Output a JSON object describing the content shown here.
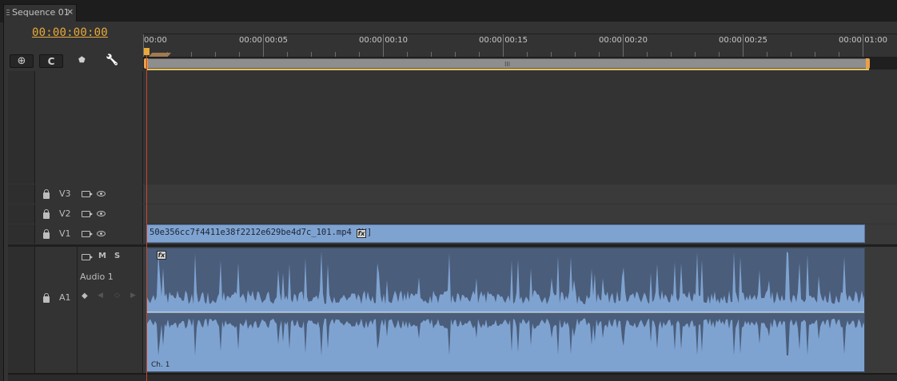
{
  "tab": {
    "label": "Sequence 01",
    "close": "×"
  },
  "timecode": "00:00:00:00",
  "toolbar": {
    "snap_glyph": "⊕",
    "linked_glyph": "C",
    "marker_glyph": "⬟",
    "settings_glyph": "🔧"
  },
  "ruler": {
    "labels": [
      "00:00",
      "00:00:00:05",
      "00:00:00:10",
      "00:00:00:15",
      "00:00:00:20",
      "00:00:00:25",
      "00:00:01:00"
    ]
  },
  "zoom_grip": "III",
  "tracks": {
    "v3": {
      "name": "V3"
    },
    "v2": {
      "name": "V2"
    },
    "v1": {
      "name": "V1"
    },
    "a1": {
      "name": "A1",
      "label": "Audio 1",
      "mute": "M",
      "solo": "S"
    }
  },
  "video_clip": {
    "label": "50e356cc7f4411e38f2212e629be4d7c_101.mp4 [V]",
    "fx": "fx"
  },
  "audio_clip": {
    "fx": "fx",
    "channel": "Ch. 1"
  },
  "colors": {
    "timecode": "#e8a93a",
    "clip": "#7fa3d1",
    "playhead": "#c4452a",
    "audio_bg": "#4a5d7a"
  }
}
